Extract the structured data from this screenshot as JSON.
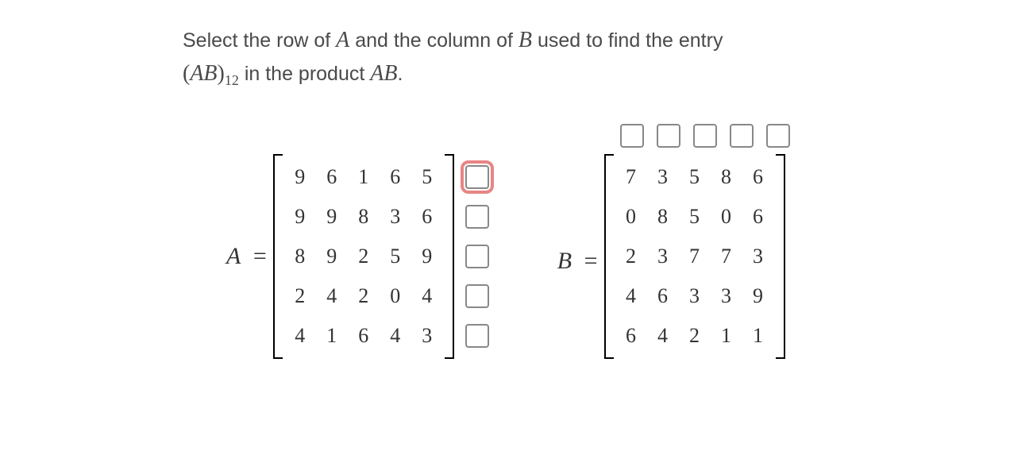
{
  "prompt": {
    "part1": "Select the row of ",
    "A": "A",
    "part2": " and the column of ",
    "B": "B",
    "part3": " used to find the entry ",
    "lparen": "(",
    "AB": "AB",
    "rparen": ")",
    "sub": "12",
    "part4": " in the product ",
    "AB2": "AB",
    "period": "."
  },
  "labels": {
    "A": "A",
    "B": "B",
    "eq": "="
  },
  "matrixA": [
    [
      "9",
      "6",
      "1",
      "6",
      "5"
    ],
    [
      "9",
      "9",
      "8",
      "3",
      "6"
    ],
    [
      "8",
      "9",
      "2",
      "5",
      "9"
    ],
    [
      "2",
      "4",
      "2",
      "0",
      "4"
    ],
    [
      "4",
      "1",
      "6",
      "4",
      "3"
    ]
  ],
  "matrixB": [
    [
      "7",
      "3",
      "5",
      "8",
      "6"
    ],
    [
      "0",
      "8",
      "5",
      "0",
      "6"
    ],
    [
      "2",
      "3",
      "7",
      "7",
      "3"
    ],
    [
      "4",
      "6",
      "3",
      "3",
      "9"
    ],
    [
      "6",
      "4",
      "2",
      "1",
      "1"
    ]
  ],
  "rowSelected": 0,
  "colSelected": -1
}
